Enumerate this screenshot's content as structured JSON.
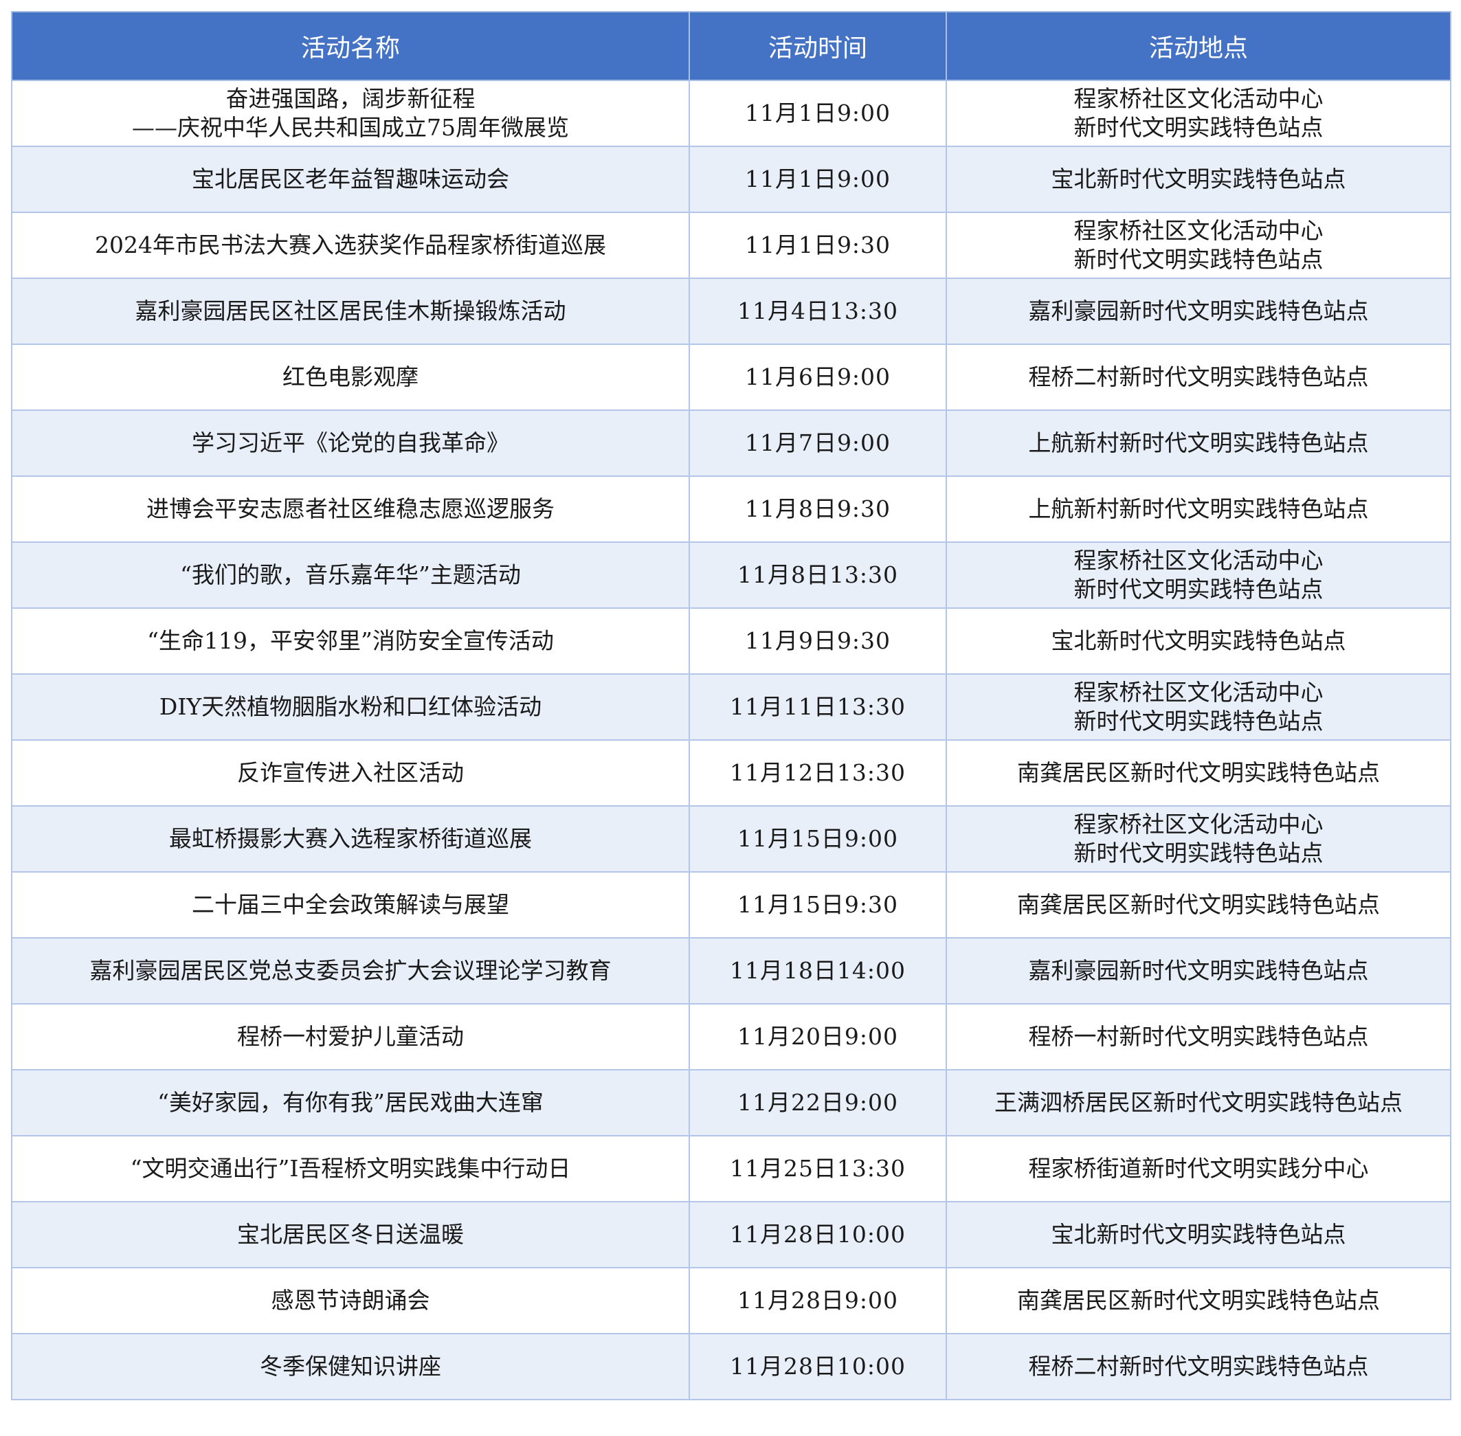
{
  "table": {
    "headers": [
      "活动名称",
      "活动时间",
      "活动地点"
    ],
    "rows": [
      {
        "name": "奋进强国路，阔步新征程\n——庆祝中华人民共和国成立75周年微展览",
        "time": "11月1日9:00",
        "place": "程家桥社区文化活动中心\n新时代文明实践特色站点"
      },
      {
        "name": "宝北居民区老年益智趣味运动会",
        "time": "11月1日9:00",
        "place": "宝北新时代文明实践特色站点"
      },
      {
        "name": "2024年市民书法大赛入选获奖作品程家桥街道巡展",
        "time": "11月1日9:30",
        "place": "程家桥社区文化活动中心\n新时代文明实践特色站点"
      },
      {
        "name": "嘉利豪园居民区社区居民佳木斯操锻炼活动",
        "time": "11月4日13:30",
        "place": "嘉利豪园新时代文明实践特色站点"
      },
      {
        "name": "红色电影观摩",
        "time": "11月6日9:00",
        "place": "程桥二村新时代文明实践特色站点"
      },
      {
        "name": "学习习近平《论党的自我革命》",
        "time": "11月7日9:00",
        "place": "上航新村新时代文明实践特色站点"
      },
      {
        "name": "进博会平安志愿者社区维稳志愿巡逻服务",
        "time": "11月8日9:30",
        "place": "上航新村新时代文明实践特色站点"
      },
      {
        "name": "“我们的歌，音乐嘉年华”主题活动",
        "time": "11月8日13:30",
        "place": "程家桥社区文化活动中心\n新时代文明实践特色站点"
      },
      {
        "name": "“生命119，平安邻里”消防安全宣传活动",
        "time": "11月9日9:30",
        "place": "宝北新时代文明实践特色站点"
      },
      {
        "name": "DIY天然植物胭脂水粉和口红体验活动",
        "time": "11月11日13:30",
        "place": "程家桥社区文化活动中心\n新时代文明实践特色站点"
      },
      {
        "name": "反诈宣传进入社区活动",
        "time": "11月12日13:30",
        "place": "南龚居民区新时代文明实践特色站点"
      },
      {
        "name": "最虹桥摄影大赛入选程家桥街道巡展",
        "time": "11月15日9:00",
        "place": "程家桥社区文化活动中心\n新时代文明实践特色站点"
      },
      {
        "name": "二十届三中全会政策解读与展望",
        "time": "11月15日9:30",
        "place": "南龚居民区新时代文明实践特色站点"
      },
      {
        "name": "嘉利豪园居民区党总支委员会扩大会议理论学习教育",
        "time": "11月18日14:00",
        "place": "嘉利豪园新时代文明实践特色站点"
      },
      {
        "name": "程桥一村爱护儿童活动",
        "time": "11月20日9:00",
        "place": "程桥一村新时代文明实践特色站点"
      },
      {
        "name": "“美好家园，有你有我”居民戏曲大连窜",
        "time": "11月22日9:00",
        "place": "王满泗桥居民区新时代文明实践特色站点"
      },
      {
        "name": "“文明交通出行”I吾程桥文明实践集中行动日",
        "time": "11月25日13:30",
        "place": "程家桥街道新时代文明实践分中心"
      },
      {
        "name": "宝北居民区冬日送温暖",
        "time": "11月28日10:00",
        "place": "宝北新时代文明实践特色站点"
      },
      {
        "name": "感恩节诗朗诵会",
        "time": "11月28日9:00",
        "place": "南龚居民区新时代文明实践特色站点"
      },
      {
        "name": "冬季保健知识讲座",
        "time": "11月28日10:00",
        "place": "程桥二村新时代文明实践特色站点"
      }
    ]
  },
  "colors": {
    "header_bg": "#4472c4",
    "header_text": "#ffffff",
    "stripe_bg": "#e9eff9",
    "grid_line": "#b4c6e7"
  }
}
